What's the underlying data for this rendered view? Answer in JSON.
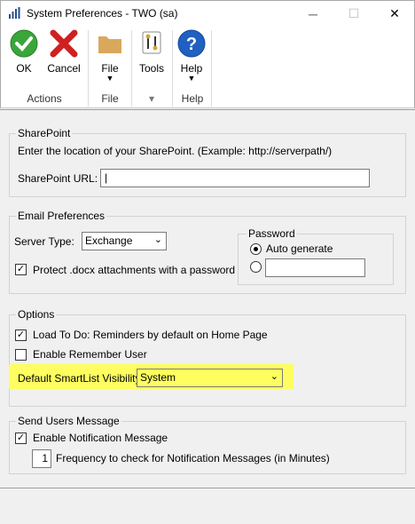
{
  "window": {
    "title": "System Preferences  -  TWO (sa)",
    "min_glyph": "─",
    "max_glyph": "☐",
    "close_glyph": "✕"
  },
  "ribbon": {
    "ok": "OK",
    "cancel": "Cancel",
    "file": "File",
    "tools": "Tools",
    "help": "Help",
    "groups": {
      "actions": "Actions",
      "file": "File",
      "tools": "",
      "help": "Help"
    },
    "caret": "▼",
    "small_caret": "▾"
  },
  "sharepoint": {
    "group_title": "SharePoint",
    "hint": "Enter the location of your SharePoint. (Example: http://serverpath/)",
    "url_label": "SharePoint URL:",
    "url_value": "|"
  },
  "email": {
    "group_title": "Email Preferences",
    "server_type_label": "Server Type:",
    "server_type_value": "Exchange",
    "protect_label": "Protect .docx attachments with a password",
    "protect_checked": "✓",
    "password": {
      "title": "Password",
      "auto_generate": "Auto generate",
      "custom_value": ""
    }
  },
  "options": {
    "group_title": "Options",
    "load_todo": "Load To Do: Reminders by default on Home Page",
    "load_todo_checked": "✓",
    "remember_user": "Enable Remember User",
    "smartlist_label": "Default SmartList Visibility:",
    "smartlist_value": "System",
    "highlight_color": "#fefe60"
  },
  "send_message": {
    "group_title": "Send Users Message",
    "enable": "Enable Notification Message",
    "enable_checked": "✓",
    "frequency_value": "1",
    "frequency_label": "Frequency to check for Notification Messages (in Minutes)"
  },
  "dropdown_arrow": "⌄"
}
